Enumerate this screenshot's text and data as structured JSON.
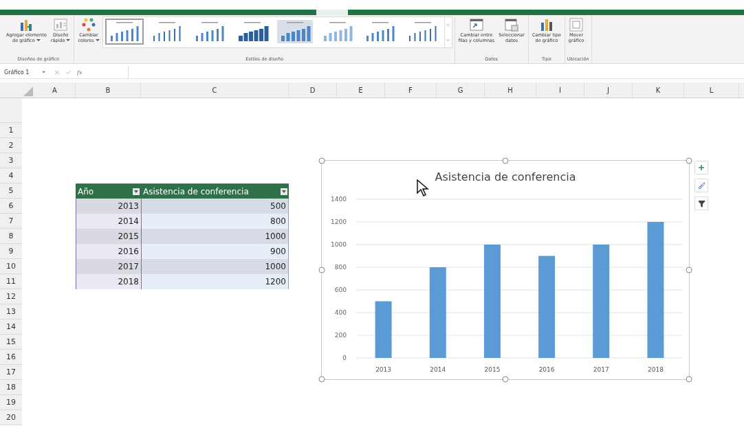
{
  "ribbon": {
    "groups": [
      {
        "label": "Diseños de gráfico",
        "buttons": [
          {
            "kind": "add-element",
            "lines": [
              "Agregar elemento",
              "de gráfico"
            ],
            "dropdown": true
          },
          {
            "kind": "quick-layout",
            "lines": [
              "Diseño",
              "rápido"
            ],
            "dropdown": true
          }
        ]
      },
      {
        "label": "Estilos de diseño",
        "buttons": [
          {
            "kind": "colors",
            "lines": [
              "Cambiar",
              "colores"
            ],
            "dropdown": true
          }
        ],
        "gallery": [
          {
            "kind": "plain",
            "selected": true
          },
          {
            "kind": "thin",
            "selected": false
          },
          {
            "kind": "plain",
            "selected": false
          },
          {
            "kind": "solid",
            "selected": false
          },
          {
            "kind": "shaded",
            "selected": false
          },
          {
            "kind": "light",
            "selected": false
          },
          {
            "kind": "plain",
            "selected": false
          },
          {
            "kind": "thin",
            "selected": false
          }
        ]
      },
      {
        "label": "Datos",
        "buttons": [
          {
            "kind": "switch",
            "lines": [
              "Cambiar entre",
              "filas y columnas"
            ],
            "dropdown": false
          },
          {
            "kind": "select",
            "lines": [
              "Seleccionar",
              "datos"
            ],
            "dropdown": false
          }
        ]
      },
      {
        "label": "Tipo",
        "buttons": [
          {
            "kind": "chart-type",
            "lines": [
              "Cambiar tipo",
              "de gráfico"
            ],
            "dropdown": false
          }
        ]
      },
      {
        "label": "Ubicación",
        "buttons": [
          {
            "kind": "move",
            "lines": [
              "Mover",
              "gráfico"
            ],
            "dropdown": false
          }
        ]
      }
    ]
  },
  "formula_bar": {
    "name_box": "Gráfico 1",
    "fx": "fx"
  },
  "columns": [
    "A",
    "B",
    "C",
    "D",
    "E",
    "F",
    "G",
    "H",
    "I",
    "J",
    "K",
    "L"
  ],
  "rows": [
    "1",
    "2",
    "3",
    "4",
    "5",
    "6",
    "7",
    "8",
    "9",
    "10",
    "11",
    "12",
    "13",
    "14",
    "15",
    "16",
    "17",
    "18",
    "19",
    "20"
  ],
  "table": {
    "columns": [
      "Año",
      "Asistencia de conferencia"
    ],
    "rows": [
      [
        "2013",
        "500"
      ],
      [
        "2014",
        "800"
      ],
      [
        "2015",
        "1000"
      ],
      [
        "2016",
        "900"
      ],
      [
        "2017",
        "1000"
      ],
      [
        "2018",
        "1200"
      ]
    ]
  },
  "chart": {
    "chart_data": {
      "type": "bar",
      "title": "Asistencia de conferencia",
      "categories": [
        "2013",
        "2014",
        "2015",
        "2016",
        "2017",
        "2018"
      ],
      "series": [
        {
          "color": "#5b9bd5",
          "values": [
            500,
            800,
            1000,
            900,
            1000,
            1200
          ]
        }
      ],
      "ylim": [
        0,
        1400
      ],
      "yticks": [
        0,
        200,
        400,
        600,
        800,
        1000,
        1200,
        1400
      ],
      "grid": true
    }
  }
}
